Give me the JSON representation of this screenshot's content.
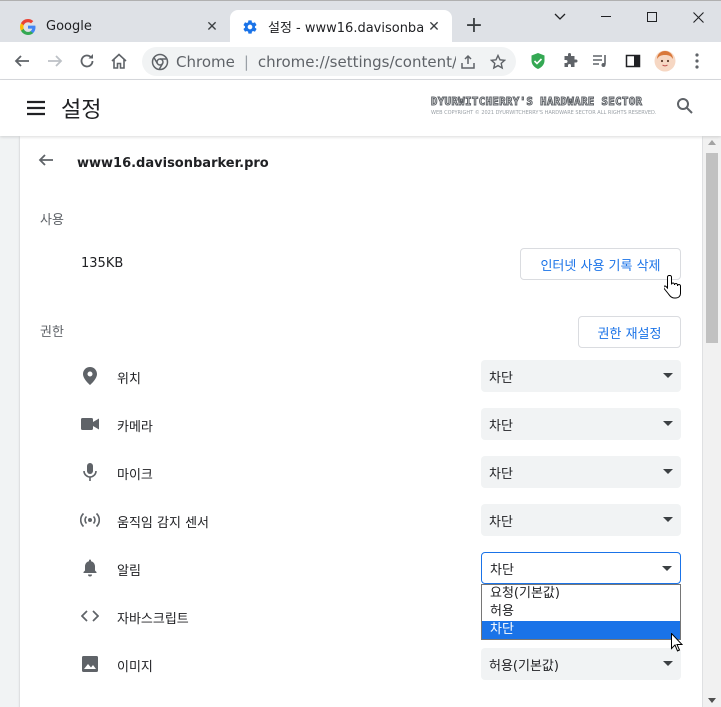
{
  "tabs": [
    {
      "title": "Google",
      "icon": "google-logo-icon",
      "active": false
    },
    {
      "title": "설정 - www16.davisonbarker.pro",
      "icon": "gear-icon",
      "active": true
    }
  ],
  "toolbar": {
    "site_label": "Chrome",
    "url": "chrome://settings/content/siteDetails?site=https://www16.davisonbarker.pro"
  },
  "header": {
    "title": "설정",
    "watermark_line1": "DYURWITCHERRY'S HARDWARE SECTOR",
    "watermark_line2": "WEB COPYRIGHT © 2021 DYURWITCHERRY'S HARDWARE SECTOR ALL RIGHTS RESERVED."
  },
  "site": {
    "name": "www16.davisonbarker.pro",
    "usage_label": "사용",
    "usage_value": "135KB",
    "clear_button": "인터넷 사용 기록 삭제",
    "permissions_label": "권한",
    "reset_button": "권한 재설정"
  },
  "permissions": [
    {
      "label": "위치",
      "icon": "location-pin-icon",
      "value": "차단"
    },
    {
      "label": "카메라",
      "icon": "camera-icon",
      "value": "차단"
    },
    {
      "label": "마이크",
      "icon": "microphone-icon",
      "value": "차단"
    },
    {
      "label": "움직임 감지 센서",
      "icon": "motion-sensor-icon",
      "value": "차단"
    },
    {
      "label": "알림",
      "icon": "bell-icon",
      "value": "차단"
    },
    {
      "label": "자바스크립트",
      "icon": "code-icon",
      "value": ""
    },
    {
      "label": "이미지",
      "icon": "image-icon",
      "value": "허용(기본값)"
    }
  ],
  "dropdown_options": [
    "요청(기본값)",
    "허용",
    "차단"
  ],
  "dropdown_selected": "차단",
  "colors": {
    "accent": "#1a73e8",
    "page_bg": "#f1f3f4",
    "tabstrip_bg": "#dee1e6"
  }
}
